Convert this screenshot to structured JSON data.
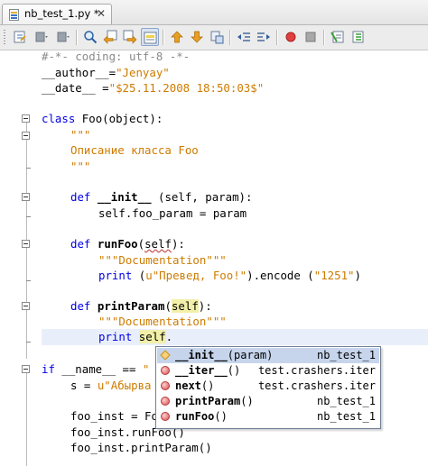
{
  "tab": {
    "title": "nb_test_1.py *",
    "close_symbol": "✕"
  },
  "toolbar": {
    "buttons": [
      {
        "name": "last-edit-icon"
      },
      {
        "name": "back-icon"
      },
      {
        "name": "forward-icon"
      },
      {
        "name": "find-icon"
      },
      {
        "name": "find-previous-icon"
      },
      {
        "name": "find-next-icon"
      },
      {
        "name": "toggle-highlight-icon",
        "active": true
      },
      {
        "name": "previous-bookmark-icon"
      },
      {
        "name": "next-bookmark-icon"
      },
      {
        "name": "toggle-bookmark-icon"
      },
      {
        "name": "shift-left-icon"
      },
      {
        "name": "shift-right-icon"
      },
      {
        "name": "start-macro-icon"
      },
      {
        "name": "stop-macro-icon"
      },
      {
        "name": "comment-icon"
      },
      {
        "name": "uncomment-icon"
      }
    ]
  },
  "code": {
    "l1": "#-*- coding: utf-8 -*-",
    "l2_a": "__author__=",
    "l2_b": "\"Jenyay\"",
    "l3_a": "__date__ =",
    "l3_b": "\"$25.11.2008 18:50:03$\"",
    "l5_kw": "class",
    "l5_rest": " Foo(object):",
    "l6": "\"\"\"",
    "l7": "Описание класса Foo",
    "l8": "\"\"\"",
    "l10_kw": "def",
    "l10_name": "__init__",
    "l10_a": " (",
    "l10_self": "self",
    "l10_b": ", param):",
    "l11_self": "self",
    "l11_rest": ".foo_param = param",
    "l13_kw": "def",
    "l13_name": "runFoo",
    "l13_a": "(",
    "l13_self": "self",
    "l13_b": "):",
    "l14": "\"\"\"Documentation\"\"\"",
    "l15_kw": "print",
    "l15_a": " (",
    "l15_str": "u\"Превед, Foo!\"",
    "l15_b": ").encode (",
    "l15_str2": "\"1251\"",
    "l15_c": ")",
    "l17_kw": "def",
    "l17_name": "printParam",
    "l17_a": "(",
    "l17_self": "self",
    "l17_b": "):",
    "l18": "\"\"\"Documentation\"\"\"",
    "l19_kw": "print",
    "l19_sp": " ",
    "l19_self": "self",
    "l19_dot": ".",
    "l21_kw": "if",
    "l21_rest": " __name__ == ",
    "l21_str": "\"",
    "l22_a": "s = ",
    "l22_str": "u\"Абырва",
    "l24": "foo_inst = Fo",
    "l25": "foo_inst.runFoo()",
    "l26": "foo_inst.printParam()"
  },
  "completion": {
    "items": [
      {
        "icon": "ctor",
        "name": "__init__",
        "args": "(param)",
        "source": "nb_test_1",
        "selected": true
      },
      {
        "icon": "method",
        "name": "__iter__",
        "args": "()",
        "source": "test.crashers.iter",
        "selected": false
      },
      {
        "icon": "method",
        "name": "next",
        "args": "()",
        "source": "test.crashers.iter",
        "selected": false
      },
      {
        "icon": "method",
        "name": "printParam",
        "args": "()",
        "source": "nb_test_1",
        "selected": false
      },
      {
        "icon": "method",
        "name": "runFoo",
        "args": "()",
        "source": "nb_test_1",
        "selected": false
      }
    ]
  }
}
